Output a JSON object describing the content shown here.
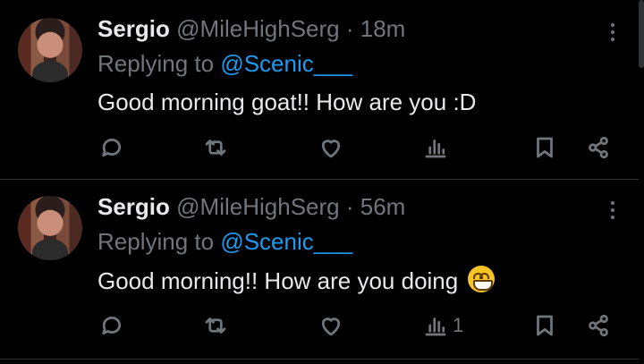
{
  "tweets": [
    {
      "name": "Sergio",
      "handle": "@MileHighSerg",
      "dot": "·",
      "time": "18m",
      "replying_prefix": "Replying to",
      "replying_to": "@Scenic___",
      "text": "Good morning goat!! How are you :D",
      "emoji": "",
      "views": ""
    },
    {
      "name": "Sergio",
      "handle": "@MileHighSerg",
      "dot": "·",
      "time": "56m",
      "replying_prefix": "Replying to",
      "replying_to": "@Scenic___",
      "text": "Good morning!! How are you doing",
      "emoji": "grinning-face-emoji",
      "views": "1"
    }
  ],
  "icons": {
    "reply": "speech-bubble-icon",
    "retweet": "retweet-arrows-icon",
    "like": "heart-icon",
    "views": "bar-chart-icon",
    "bookmark": "bookmark-icon",
    "share": "share-nodes-icon",
    "more": "vertical-dots-icon"
  },
  "colors": {
    "background": "#000000",
    "text": "#e7e9ea",
    "muted": "#71767b",
    "link": "#1d9bf0",
    "divider": "#2f3336"
  }
}
